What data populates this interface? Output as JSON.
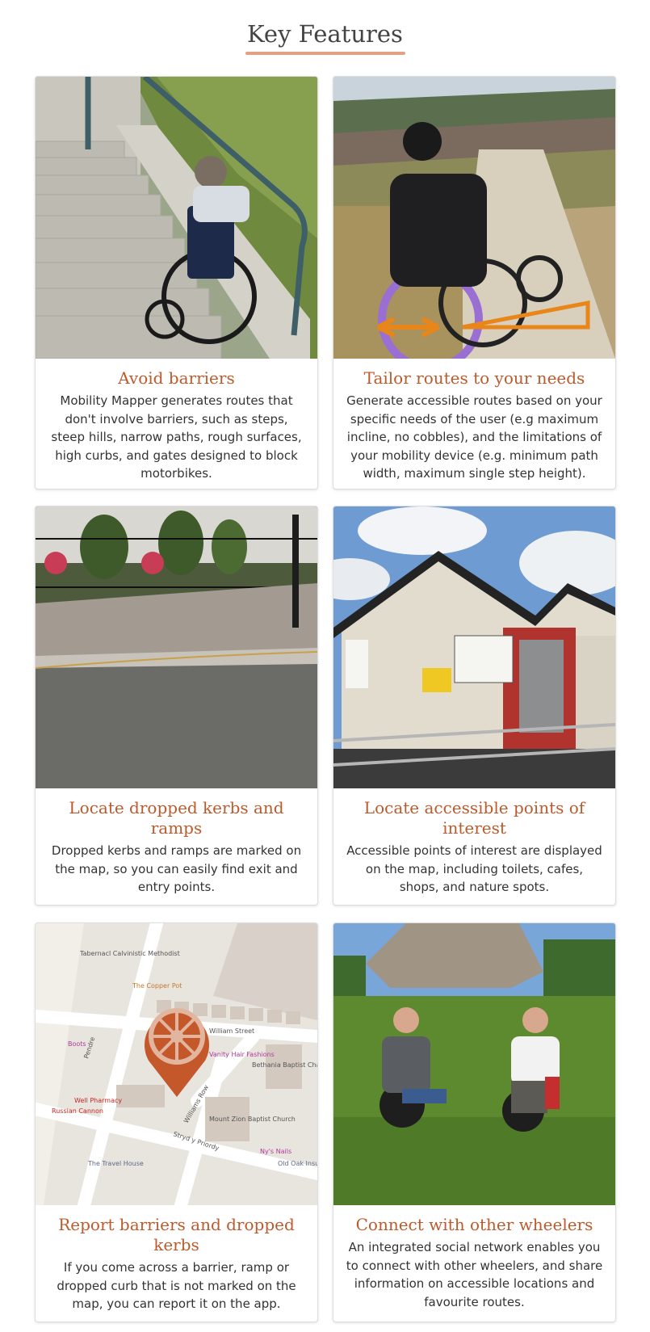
{
  "section": {
    "heading": "Key Features"
  },
  "features": [
    {
      "title": "Avoid barriers",
      "description": "Mobility Mapper generates routes that don't involve barriers, such as steps, steep hills, narrow paths, rough surfaces, high curbs, and gates designed to block motorbikes.",
      "image": "wheelchair-at-steps-photo"
    },
    {
      "title": "Tailor routes to your needs",
      "description": "Generate accessible routes based on your specific needs of the user (e.g maximum incline, no cobbles), and the limitations of your mobility device (e.g. minimum path width, maximum single step height).",
      "image": "wheelchair-on-hill-path-photo"
    },
    {
      "title": "Locate dropped kerbs and ramps",
      "description": "Dropped kerbs and ramps are marked on the map, so you can easily find exit and entry points.",
      "image": "dropped-kerb-photo"
    },
    {
      "title": "Locate accessible points of interest",
      "description": "Accessible points of interest are displayed on the map, including toilets, cafes, shops, and nature spots.",
      "image": "accessible-toilet-block-photo"
    },
    {
      "title": "Report barriers and dropped kerbs",
      "description": "If you come across a barrier, ramp or dropped curb that is not marked on the map, you can report it on the app.",
      "image": "map-with-wheel-pin",
      "map_labels": {
        "street1": "William Street",
        "street2": "Stryd y Priordy",
        "street3": "Williams Row",
        "street4": "Pendre",
        "place1": "Tabernacl Calvinistic Methodist",
        "place2": "The Copper Pot",
        "place3": "Well Pharmacy",
        "place4": "Bethania Baptist Chapel",
        "place5": "Mount Zion Baptist Church",
        "place6": "Vanity Hair Fashions",
        "place7": "Boots",
        "place8": "The Travel House",
        "place9": "Ny's Nails",
        "place10": "Old Oak Insurance",
        "place11": "Russian Cannon"
      }
    },
    {
      "title": "Connect with other wheelers",
      "description": "An integrated social network enables you to connect with other wheelers, and share information on accessible locations and favourite routes.",
      "image": "two-wheelers-fist-bump-photo"
    }
  ],
  "colors": {
    "accent": "#bd5a2c",
    "underline": "#e2a183",
    "pin": "#c4582a"
  }
}
